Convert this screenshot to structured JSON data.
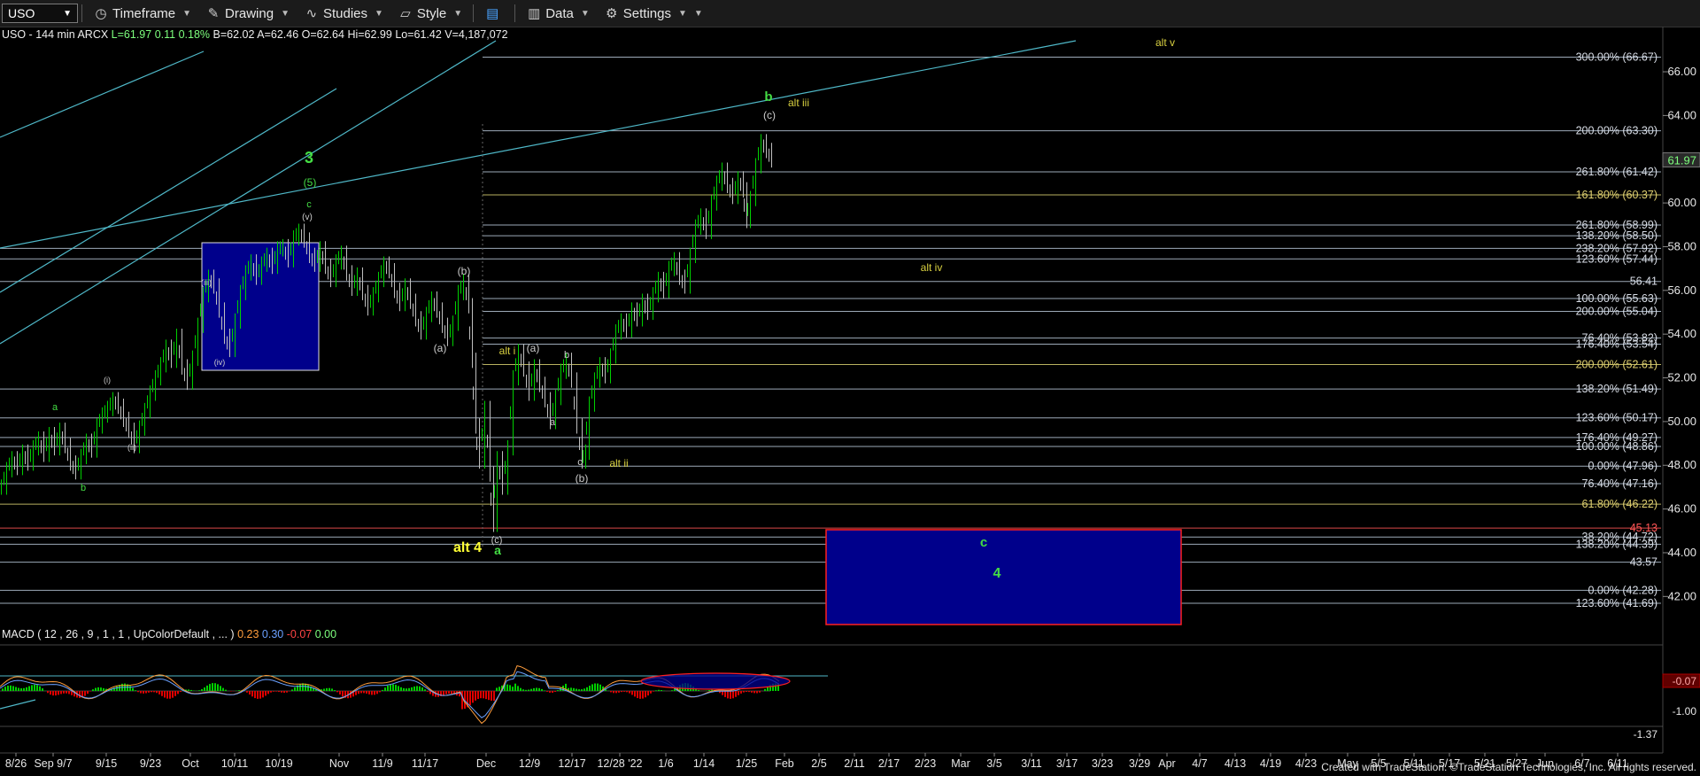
{
  "toolbar": {
    "symbol": "USO",
    "timeframe": "Timeframe",
    "drawing": "Drawing",
    "studies": "Studies",
    "style": "Style",
    "data": "Data",
    "settings": "Settings"
  },
  "ohlc": {
    "title": "USO - 144 min  ARCX",
    "last": "L=61.97",
    "chg": "0.11",
    "pct": "0.18%",
    "bid": "B=62.02",
    "ask": "A=62.46",
    "open": "O=62.64",
    "high": "Hi=62.99",
    "low": "Lo=61.42",
    "vol": "V=4,187,072"
  },
  "macd": {
    "title": "MACD ( 12 , 26 , 9 , 1 , 1 , UpColorDefault , ... )",
    "v1": "0.23",
    "v2": "0.30",
    "v3": "-0.07",
    "v4": "0.00",
    "axis_bottom": "-1.37",
    "axis_value": "-1.00",
    "last_tag": "-0.07"
  },
  "colors": {
    "up": "#00d000",
    "down": "#e00000",
    "wave_green": "#44dd44",
    "wave_yellow": "#ffff33",
    "fib_line": "#b8c8d8",
    "trend_line": "#4fb8c8",
    "box_fill": "#00008b"
  },
  "chart_data": {
    "type": "candlestick",
    "symbol": "USO",
    "y_axis_ticks": [
      "66.00",
      "64.00",
      "62.00",
      "60.00",
      "58.00",
      "56.00",
      "54.00",
      "52.00",
      "50.00",
      "48.00",
      "46.00",
      "44.00",
      "42.00"
    ],
    "last_price": "61.97",
    "x_axis_ticks": [
      "8/26",
      "Sep 9/7",
      "9/15",
      "9/23",
      "Oct",
      "10/11",
      "10/19",
      "Nov",
      "11/9",
      "11/17",
      "Dec",
      "12/9",
      "12/17",
      "12/28 '22",
      "1/6",
      "1/14",
      "1/25",
      "Feb",
      "2/5",
      "2/11",
      "2/17",
      "2/23",
      "Mar",
      "3/5",
      "3/11",
      "3/17",
      "3/23",
      "3/29",
      "Apr",
      "4/7",
      "4/13",
      "4/19",
      "4/23",
      "May",
      "5/5",
      "5/11",
      "5/17",
      "5/21",
      "5/27",
      "Jun",
      "6/7",
      "6/11"
    ],
    "fib_levels": [
      {
        "label": "300.00% (66.67)",
        "value": 66.67
      },
      {
        "label": "200.00% (63.30)",
        "value": 63.3
      },
      {
        "label": "261.80% (61.42)",
        "value": 61.42
      },
      {
        "label": "161.80% (60.37)",
        "value": 60.37
      },
      {
        "label": "261.80% (58.99)",
        "value": 58.99
      },
      {
        "label": "138.20% (58.50)",
        "value": 58.5
      },
      {
        "label": "238.20% (57.92)",
        "value": 57.92
      },
      {
        "label": "123.60% (57.44)",
        "value": 57.44
      },
      {
        "label": "56.41",
        "value": 56.41
      },
      {
        "label": "100.00% (55.63)",
        "value": 55.63
      },
      {
        "label": "200.00% (55.04)",
        "value": 55.04
      },
      {
        "label": "76.40% (53.82)",
        "value": 53.82
      },
      {
        "label": "176.40% (53.54)",
        "value": 53.54
      },
      {
        "label": "200.00% (52.61)",
        "value": 52.61
      },
      {
        "label": "138.20% (51.49)",
        "value": 51.49
      },
      {
        "label": "123.60% (50.17)",
        "value": 50.17
      },
      {
        "label": "176.40% (49.27)",
        "value": 49.27
      },
      {
        "label": "100.00% (48.86)",
        "value": 48.86
      },
      {
        "label": "0.00% (47.96)",
        "value": 47.96
      },
      {
        "label": "76.40% (47.16)",
        "value": 47.16
      },
      {
        "label": "61.80% (46.22)",
        "value": 46.22
      },
      {
        "label": "45.13",
        "value": 45.13
      },
      {
        "label": "38.20% (44.72)",
        "value": 44.72
      },
      {
        "label": "138.20% (44.39)",
        "value": 44.39
      },
      {
        "label": "43.57",
        "value": 43.57
      },
      {
        "label": "0.00% (42.28)",
        "value": 42.28
      },
      {
        "label": "123.60% (41.69)",
        "value": 41.69
      }
    ],
    "wave_labels": [
      {
        "text": "alt v"
      },
      {
        "text": "b"
      },
      {
        "text": "alt iii"
      },
      {
        "text": "(c)"
      },
      {
        "text": "3"
      },
      {
        "text": "(5)"
      },
      {
        "text": "c"
      },
      {
        "text": "(v)"
      },
      {
        "text": "alt iv"
      },
      {
        "text": "(b)"
      },
      {
        "text": "(iii)"
      },
      {
        "text": "(iv)"
      },
      {
        "text": "(a)"
      },
      {
        "text": "alt i"
      },
      {
        "text": "(a)"
      },
      {
        "text": "b"
      },
      {
        "text": "(i)"
      },
      {
        "text": "a"
      },
      {
        "text": "a"
      },
      {
        "text": "(ii)"
      },
      {
        "text": "c"
      },
      {
        "text": "alt ii"
      },
      {
        "text": "(b)"
      },
      {
        "text": "b"
      },
      {
        "text": "alt 4"
      },
      {
        "text": "a"
      },
      {
        "text": "(c)"
      },
      {
        "text": "c"
      },
      {
        "text": "4"
      }
    ],
    "price_series": [
      [
        0,
        47.0
      ],
      [
        6,
        47.8
      ],
      [
        12,
        48.3
      ],
      [
        18,
        47.9
      ],
      [
        24,
        48.6
      ],
      [
        30,
        48.1
      ],
      [
        36,
        48.8
      ],
      [
        42,
        49.2
      ],
      [
        48,
        48.5
      ],
      [
        54,
        49.4
      ],
      [
        60,
        48.8
      ],
      [
        66,
        49.6
      ],
      [
        72,
        48.9
      ],
      [
        78,
        48.1
      ],
      [
        84,
        47.7
      ],
      [
        90,
        48.4
      ],
      [
        96,
        49.1
      ],
      [
        102,
        48.7
      ],
      [
        108,
        49.8
      ],
      [
        114,
        50.3
      ],
      [
        120,
        50.6
      ],
      [
        126,
        51.0
      ],
      [
        132,
        50.7
      ],
      [
        138,
        50.1
      ],
      [
        144,
        49.6
      ],
      [
        150,
        48.9
      ],
      [
        156,
        49.7
      ],
      [
        162,
        50.5
      ],
      [
        168,
        51.3
      ],
      [
        174,
        52.0
      ],
      [
        180,
        52.6
      ],
      [
        186,
        53.4
      ],
      [
        192,
        52.8
      ],
      [
        198,
        53.9
      ],
      [
        204,
        52.5
      ],
      [
        210,
        51.8
      ],
      [
        216,
        52.9
      ],
      [
        222,
        54.4
      ],
      [
        228,
        55.8
      ],
      [
        234,
        56.6
      ],
      [
        240,
        56.2
      ],
      [
        246,
        55.1
      ],
      [
        252,
        53.9
      ],
      [
        258,
        53.3
      ],
      [
        264,
        54.6
      ],
      [
        270,
        55.9
      ],
      [
        276,
        56.8
      ],
      [
        282,
        57.3
      ],
      [
        288,
        56.6
      ],
      [
        294,
        57.2
      ],
      [
        300,
        57.6
      ],
      [
        306,
        57.1
      ],
      [
        312,
        57.9
      ],
      [
        318,
        58.0
      ],
      [
        324,
        57.4
      ],
      [
        330,
        58.4
      ],
      [
        336,
        58.7
      ],
      [
        342,
        58.3
      ],
      [
        348,
        57.6
      ],
      [
        354,
        57.2
      ],
      [
        360,
        57.9
      ],
      [
        366,
        57.1
      ],
      [
        372,
        56.5
      ],
      [
        378,
        57.3
      ],
      [
        384,
        57.7
      ],
      [
        390,
        56.8
      ],
      [
        396,
        56.1
      ],
      [
        402,
        56.7
      ],
      [
        408,
        55.9
      ],
      [
        414,
        55.2
      ],
      [
        420,
        55.8
      ],
      [
        426,
        56.5
      ],
      [
        432,
        57.2
      ],
      [
        438,
        56.9
      ],
      [
        444,
        56.0
      ],
      [
        450,
        55.4
      ],
      [
        456,
        56.2
      ],
      [
        462,
        55.5
      ],
      [
        468,
        54.7
      ],
      [
        474,
        54.1
      ],
      [
        480,
        54.9
      ],
      [
        486,
        55.6
      ],
      [
        492,
        55.1
      ],
      [
        498,
        54.4
      ],
      [
        504,
        53.8
      ],
      [
        510,
        54.5
      ],
      [
        516,
        55.9
      ],
      [
        522,
        56.4
      ],
      [
        528,
        55.3
      ],
      [
        532,
        52.8
      ],
      [
        536,
        49.8
      ],
      [
        540,
        48.2
      ],
      [
        546,
        50.6
      ],
      [
        552,
        47.6
      ],
      [
        556,
        45.3
      ],
      [
        560,
        48.3
      ],
      [
        566,
        47.0
      ],
      [
        572,
        48.8
      ],
      [
        578,
        52.0
      ],
      [
        584,
        53.2
      ],
      [
        590,
        52.4
      ],
      [
        596,
        51.3
      ],
      [
        602,
        52.5
      ],
      [
        608,
        51.7
      ],
      [
        614,
        51.0
      ],
      [
        620,
        50.0
      ],
      [
        626,
        51.1
      ],
      [
        632,
        52.3
      ],
      [
        638,
        52.8
      ],
      [
        644,
        51.9
      ],
      [
        650,
        49.8
      ],
      [
        656,
        48.2
      ],
      [
        660,
        48.6
      ],
      [
        664,
        50.8
      ],
      [
        670,
        51.9
      ],
      [
        676,
        52.6
      ],
      [
        682,
        52.1
      ],
      [
        688,
        53.0
      ],
      [
        694,
        54.1
      ],
      [
        700,
        54.6
      ],
      [
        706,
        54.2
      ],
      [
        712,
        55.1
      ],
      [
        718,
        54.7
      ],
      [
        724,
        55.5
      ],
      [
        730,
        55.0
      ],
      [
        736,
        55.8
      ],
      [
        742,
        56.5
      ],
      [
        748,
        56.0
      ],
      [
        754,
        57.0
      ],
      [
        760,
        57.4
      ],
      [
        766,
        56.6
      ],
      [
        772,
        56.2
      ],
      [
        778,
        57.6
      ],
      [
        784,
        58.9
      ],
      [
        790,
        59.4
      ],
      [
        796,
        58.7
      ],
      [
        802,
        60.0
      ],
      [
        808,
        60.9
      ],
      [
        814,
        61.5
      ],
      [
        820,
        60.8
      ],
      [
        826,
        60.3
      ],
      [
        832,
        61.1
      ],
      [
        838,
        60.6
      ],
      [
        842,
        59.2
      ],
      [
        846,
        60.2
      ],
      [
        852,
        61.7
      ],
      [
        858,
        62.8
      ],
      [
        864,
        62.4
      ],
      [
        870,
        61.97
      ]
    ]
  }
}
